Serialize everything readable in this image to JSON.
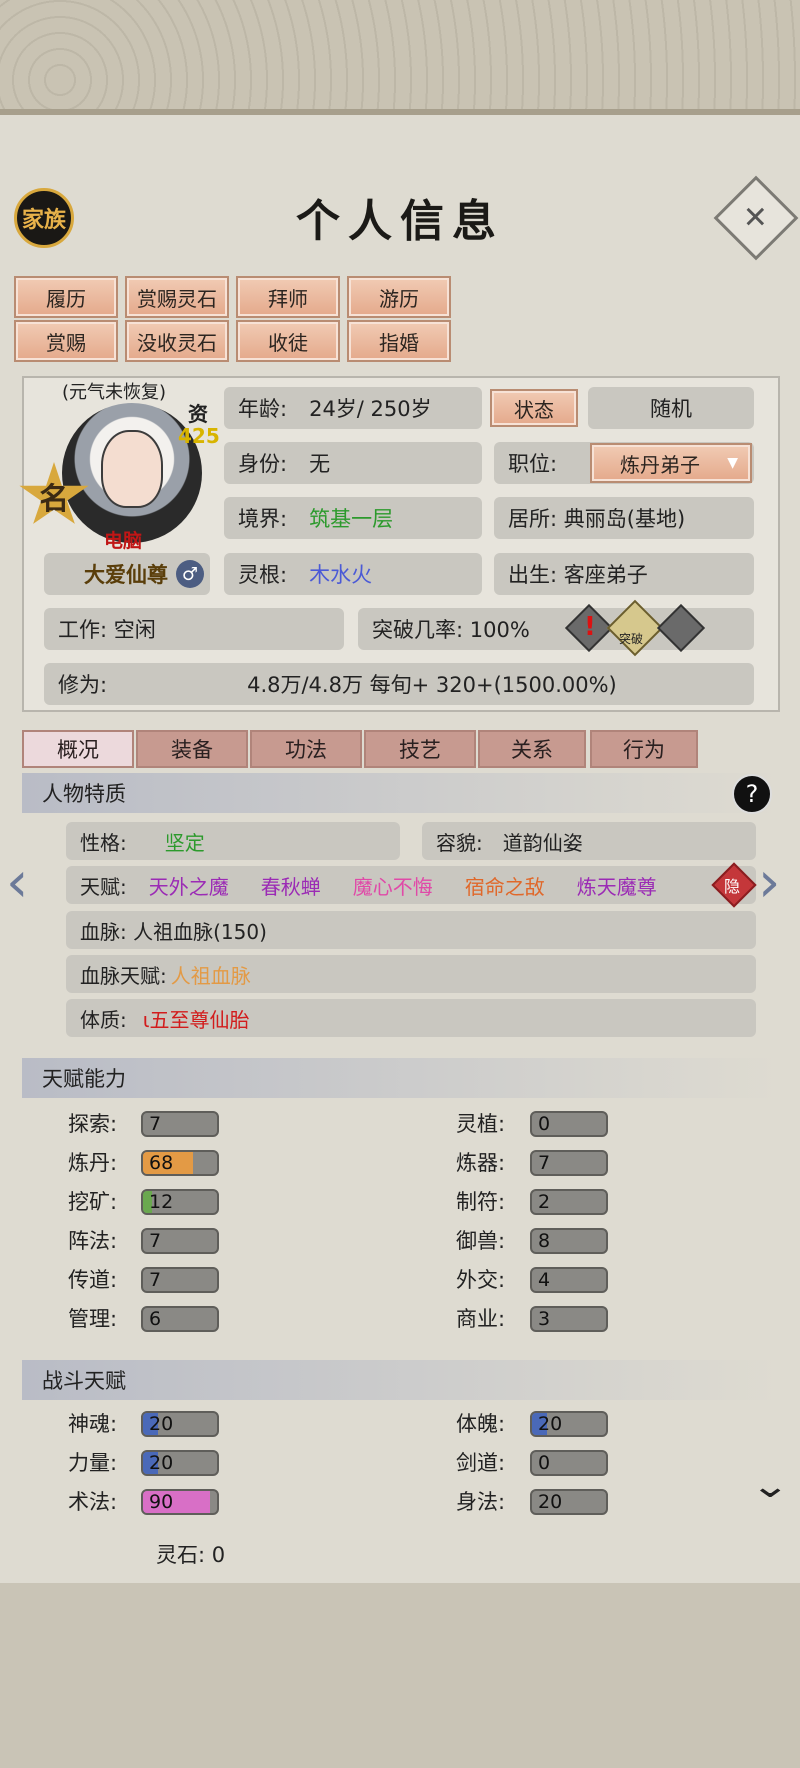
{
  "header": {
    "family": "家族",
    "title": "个人信息"
  },
  "actions": [
    "履历",
    "赏赐灵石",
    "拜师",
    "游历",
    "赏赐",
    "没收灵石",
    "收徒",
    "指婚"
  ],
  "profile": {
    "status_tag": "(元气未恢复)",
    "zi_label": "资",
    "zi_value": "425",
    "badge": "名",
    "computer_tag": "电脑",
    "name": "大爱仙尊",
    "gender_icon": "male-icon"
  },
  "info": {
    "age_label": "年龄:",
    "age_value": "24岁/ 250岁",
    "status_btn": "状态",
    "random_btn": "随机",
    "identity_label": "身份:",
    "identity_value": "无",
    "position_label": "职位:",
    "position_value": "炼丹弟子",
    "realm_label": "境界:",
    "realm_value": "筑基一层",
    "residence": "居所: 典丽岛(基地)",
    "root_label": "灵根:",
    "root_value": "木水火",
    "birth": "出生:  客座弟子",
    "work": "工作: 空闲",
    "breakthrough": "突破几率:  100%",
    "breakthrough_icon_label": "突破",
    "cultivation_label": "修为:",
    "cultivation_value": "4.8万/4.8万   每旬+   320+(1500.00%)"
  },
  "tabs": [
    "概况",
    "装备",
    "功法",
    "技艺",
    "关系",
    "行为"
  ],
  "traits": {
    "section": "人物特质",
    "personality_label": "性格:",
    "personality_value": "坚定",
    "appearance_label": "容貌:",
    "appearance_value": "道韵仙姿",
    "talent_label": "天赋:",
    "talents": [
      {
        "text": "天外之魔",
        "color": "#9b2bb5"
      },
      {
        "text": "春秋蝉",
        "color": "#9b2bb5"
      },
      {
        "text": "魔心不悔",
        "color": "#e04aa8"
      },
      {
        "text": "宿命之敌",
        "color": "#e0682a"
      },
      {
        "text": "炼天魔尊",
        "color": "#9b2bb5"
      }
    ],
    "hidden_badge": "隐",
    "bloodline": "血脉: 人祖血脉(150)",
    "bloodline_talent_label": "血脉天赋:",
    "bloodline_talent_value": "人祖血脉",
    "physique_label": "体质:",
    "physique_value": "ι五至尊仙胎"
  },
  "abilities": {
    "section": "天赋能力",
    "left": [
      {
        "label": "探索:",
        "value": "7",
        "level": 0.0
      },
      {
        "label": "炼丹:",
        "value": "68",
        "level": 0.68,
        "color": "#e39a45"
      },
      {
        "label": "挖矿:",
        "value": "12",
        "level": 0.12,
        "color": "#6aa84f"
      },
      {
        "label": "阵法:",
        "value": "7",
        "level": 0.0
      },
      {
        "label": "传道:",
        "value": "7",
        "level": 0.0
      },
      {
        "label": "管理:",
        "value": "6",
        "level": 0.0
      }
    ],
    "right": [
      {
        "label": "灵植:",
        "value": "0",
        "level": 0.0
      },
      {
        "label": "炼器:",
        "value": "7",
        "level": 0.0
      },
      {
        "label": "制符:",
        "value": "2",
        "level": 0.0
      },
      {
        "label": "御兽:",
        "value": "8",
        "level": 0.0
      },
      {
        "label": "外交:",
        "value": "4",
        "level": 0.0
      },
      {
        "label": "商业:",
        "value": "3",
        "level": 0.0
      }
    ]
  },
  "combat": {
    "section": "战斗天赋",
    "left": [
      {
        "label": "神魂:",
        "value": "20",
        "level": 0.2,
        "color": "#4a69b8"
      },
      {
        "label": "力量:",
        "value": "20",
        "level": 0.2,
        "color": "#4a69b8"
      },
      {
        "label": "术法:",
        "value": "90",
        "level": 0.9,
        "color": "#d86fc6"
      }
    ],
    "right": [
      {
        "label": "体魄:",
        "value": "20",
        "level": 0.2,
        "color": "#4a69b8"
      },
      {
        "label": "剑道:",
        "value": "0",
        "level": 0.0
      },
      {
        "label": "身法:",
        "value": "20",
        "level": 0.0
      }
    ]
  },
  "footer": {
    "spirit_stones": "灵石: 0"
  }
}
